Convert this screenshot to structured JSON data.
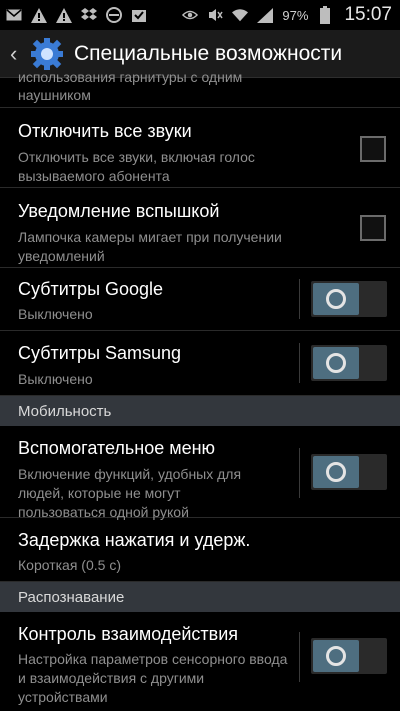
{
  "status_bar": {
    "left_icons": [
      "mail-icon",
      "warning-icon",
      "alert-icon",
      "dropbox-icon",
      "block-icon",
      "download-done-icon"
    ],
    "right_icons": [
      "eye-icon",
      "mute-icon",
      "wifi-icon",
      "signal-icon"
    ],
    "battery": "97%",
    "time": "15:07"
  },
  "action_bar": {
    "title": "Специальные возможности",
    "icon": "gear-icon"
  },
  "partial_top": {
    "line1": "использования гарнитуры с одним",
    "line2": "наушником"
  },
  "items": [
    {
      "title": "Отключить все звуки",
      "subtitle": "Отключить все звуки, включая голос вызываемого абонента",
      "control": "checkbox",
      "checked": false
    },
    {
      "title": "Уведомление вспышкой",
      "subtitle": "Лампочка камеры мигает при получении уведомлений",
      "control": "checkbox",
      "checked": false
    },
    {
      "title": "Субтитры Google",
      "subtitle": "Выключено",
      "control": "toggle",
      "on": false
    },
    {
      "title": "Субтитры Samsung",
      "subtitle": "Выключено",
      "control": "toggle",
      "on": false
    }
  ],
  "sections": {
    "mobility": "Мобильность",
    "recognition": "Распознавание"
  },
  "mobility_items": [
    {
      "title": "Вспомогательное меню",
      "subtitle": "Включение функций, удобных для людей, которые не могут пользоваться одной рукой",
      "control": "toggle",
      "on": false
    },
    {
      "title": "Задержка нажатия и удерж.",
      "subtitle": "Короткая (0.5 с)",
      "control": "none"
    }
  ],
  "recognition_items": [
    {
      "title": "Контроль взаимодействия",
      "subtitle": "Настройка параметров сенсорного ввода и взаимодействия с другими устройствами",
      "control": "toggle",
      "on": false
    }
  ],
  "colors": {
    "toggle_knob": "#4e6e80",
    "section_bg": "#33373d",
    "subtitle": "#8f8f8f"
  }
}
